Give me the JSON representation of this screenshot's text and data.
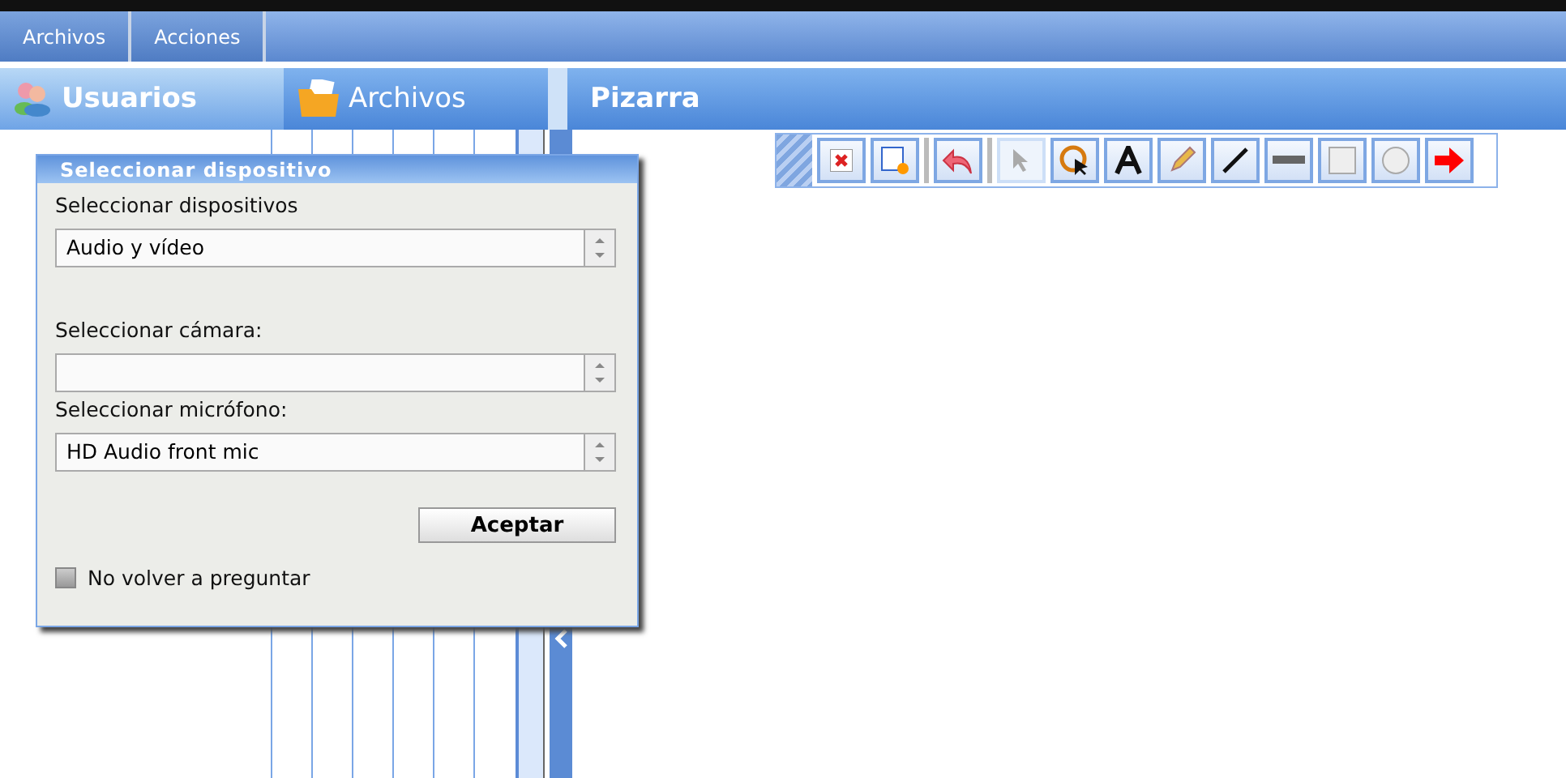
{
  "menu": [
    {
      "label": "Archivos"
    },
    {
      "label": "Acciones"
    }
  ],
  "panel_tabs": [
    {
      "label": "Usuarios",
      "kind": "users",
      "selected": true
    },
    {
      "label": "Archivos",
      "kind": "folder",
      "selected": false
    }
  ],
  "whiteboard": {
    "title": "Pizarra",
    "tools": [
      {
        "kind": "clear",
        "selected": false
      },
      {
        "kind": "new-page",
        "selected": false
      },
      {
        "kind": "sep"
      },
      {
        "kind": "undo",
        "selected": false
      },
      {
        "kind": "sep"
      },
      {
        "kind": "pointer",
        "selected": true
      },
      {
        "kind": "lasso",
        "selected": false
      },
      {
        "kind": "text",
        "selected": false
      },
      {
        "kind": "pencil",
        "selected": false
      },
      {
        "kind": "line",
        "selected": false
      },
      {
        "kind": "underline",
        "selected": false
      },
      {
        "kind": "rect",
        "selected": false
      },
      {
        "kind": "ellipse",
        "selected": false
      },
      {
        "kind": "arrow",
        "selected": false
      }
    ]
  },
  "dialog": {
    "title": "Seleccionar dispositivo",
    "fields": [
      {
        "label": "Seleccionar dispositivos",
        "value": "Audio y vídeo"
      },
      {
        "label": "Seleccionar cámara:"
      },
      {
        "label": "Seleccionar micrófono:",
        "value": "HD Audio front mic"
      }
    ],
    "button": "Aceptar",
    "checkbox": {
      "label": "No volver a preguntar",
      "checked": false
    }
  }
}
